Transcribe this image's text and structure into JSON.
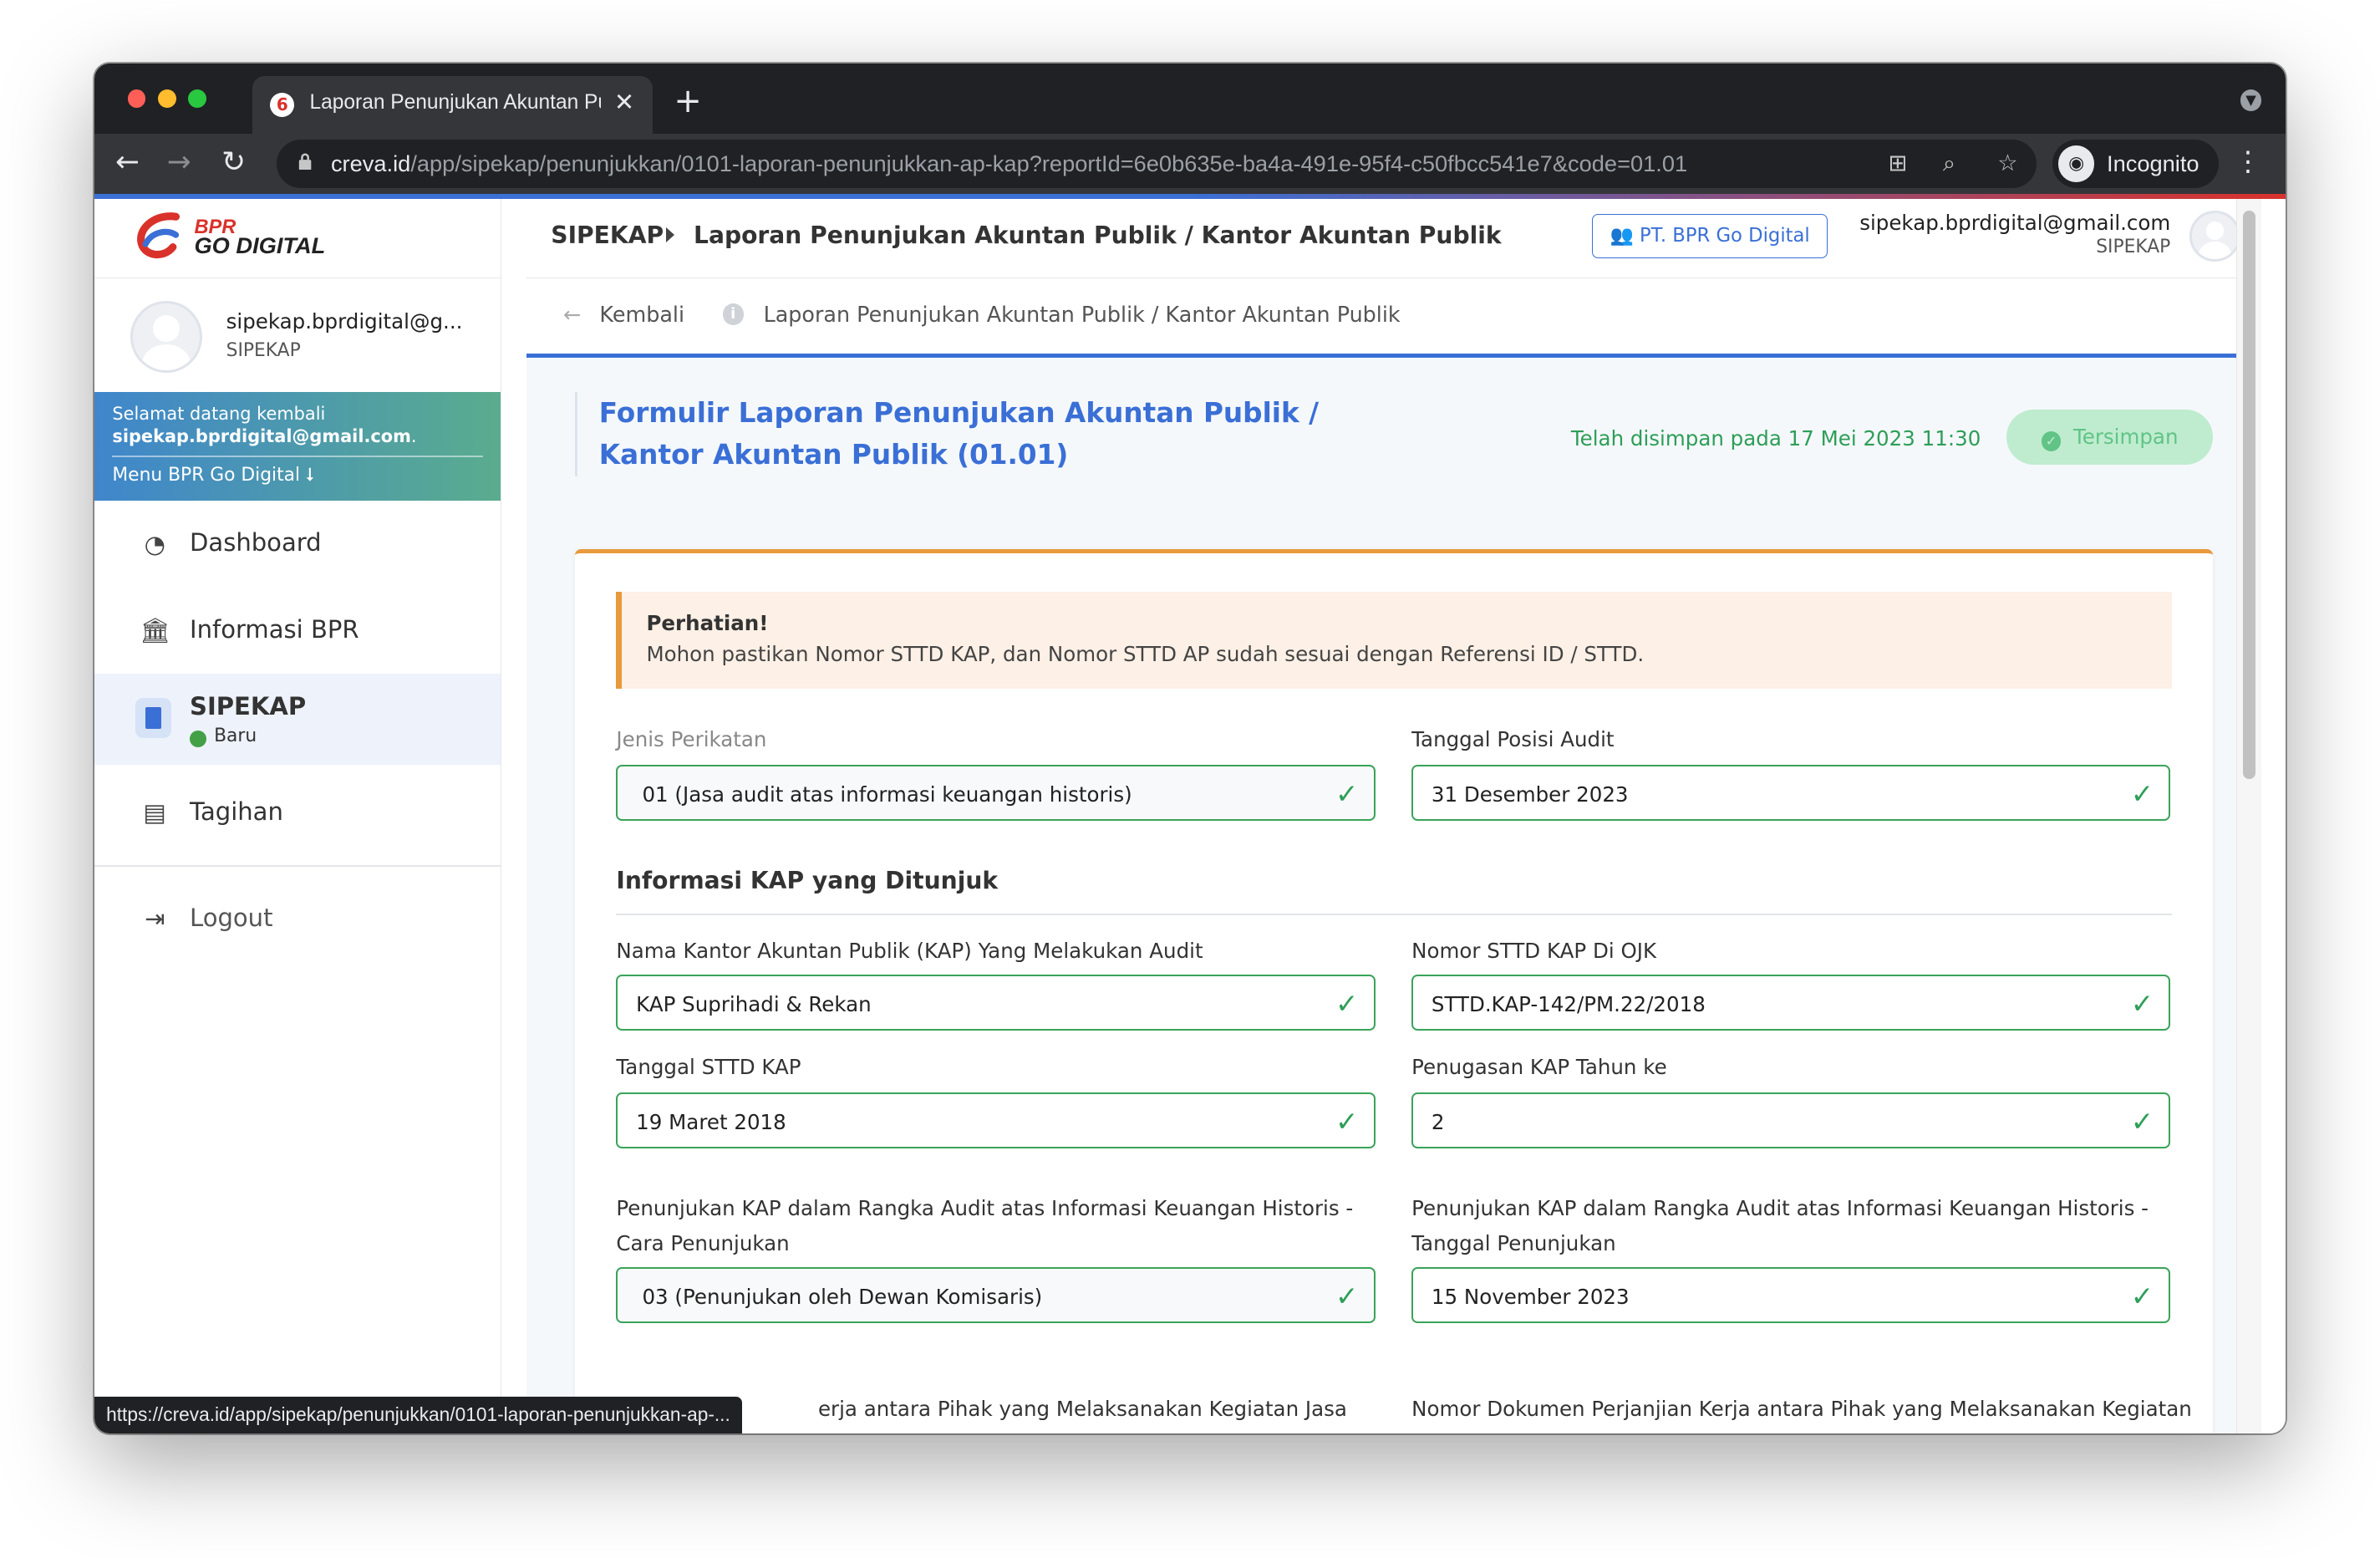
{
  "browser": {
    "tab_title": "Laporan Penunjukan Akuntan Publik / Kantor Akuntan Publik",
    "url_host": "creva.id",
    "url_path": "/app/sipekap/penunjukkan/0101-laporan-penunjukkan-ap-kap?reportId=6e0b635e-ba4a-491e-95f4-c50fbcc541e7&code=01.01",
    "incognito_label": "Incognito",
    "status_url": "https://creva.id/app/sipekap/penunjukkan/0101-laporan-penunjukkan-ap-..."
  },
  "sidebar": {
    "brand_line1": "BPR",
    "brand_line2": "GO DIGITAL",
    "user_name": "sipekap.bprdigital@g...",
    "user_role": "SIPEKAP",
    "welcome_line1": "Selamat datang kembali",
    "welcome_email": "sipekap.bprdigital@gmail.com",
    "welcome_email_suffix": ".",
    "menu_label": "Menu BPR Go Digital",
    "items": [
      {
        "label": "Dashboard",
        "icon": "dashboard-icon"
      },
      {
        "label": "Informasi BPR",
        "icon": "bank-icon"
      },
      {
        "label": "SIPEKAP",
        "icon": "clipboard-icon",
        "badge": "Baru"
      },
      {
        "label": "Tagihan",
        "icon": "billing-icon"
      }
    ],
    "logout_label": "Logout"
  },
  "header": {
    "crumb_root": "SIPEKAP",
    "crumb_page": "Laporan Penunjukan Akuntan Publik / Kantor Akuntan Publik",
    "company_button": "PT. BPR Go Digital",
    "email": "sipekap.bprdigital@gmail.com",
    "role": "SIPEKAP"
  },
  "subbar": {
    "back_label": "Kembali",
    "title": "Laporan Penunjukan Akuntan Publik / Kantor Akuntan Publik"
  },
  "form": {
    "title": "Formulir Laporan Penunjukan Akuntan Publik / Kantor Akuntan Publik (01.01)",
    "saved_text": "Telah disimpan pada 17 Mei 2023 11:30",
    "saved_button": "Tersimpan",
    "alert_title": "Perhatian!",
    "alert_body": "Mohon pastikan Nomor STTD KAP, dan Nomor STTD AP sudah sesuai dengan Referensi ID / STTD.",
    "jenis_label": "Jenis Perikatan",
    "jenis_value": "01 (Jasa audit atas informasi keuangan historis)",
    "tanggal_posisi_label": "Tanggal Posisi Audit",
    "tanggal_posisi_value": "31 Desember 2023",
    "section_kap": "Informasi KAP yang Ditunjuk",
    "nama_kap_label": "Nama Kantor Akuntan Publik (KAP) Yang Melakukan Audit",
    "nama_kap_value": "KAP Suprihadi & Rekan",
    "nomor_sttd_label": "Nomor STTD KAP Di OJK",
    "nomor_sttd_value": "STTD.KAP-142/PM.22/2018",
    "tanggal_sttd_label": "Tanggal STTD KAP",
    "tanggal_sttd_value": "19 Maret 2018",
    "penugasan_label": "Penugasan KAP Tahun ke",
    "penugasan_value": "2",
    "cara_label": "Penunjukan KAP dalam Rangka Audit atas Informasi Keuangan Historis - Cara Penunjukan",
    "cara_value": "03 (Penunjukan oleh Dewan Komisaris)",
    "tgl_penunjukan_label": "Penunjukan KAP dalam Rangka Audit atas Informasi Keuangan Historis - Tanggal Penunjukan",
    "tgl_penunjukan_value": "15 November 2023",
    "partial_left_label": "erja antara Pihak yang Melaksanakan Kegiatan Jasa",
    "partial_right_label": "Nomor Dokumen Perjanjian Kerja antara Pihak yang Melaksanakan Kegiatan"
  },
  "colors": {
    "primary": "#3a6fd6",
    "success": "#2e9e58",
    "warning": "#e89a3c",
    "brand_red": "#d9322b"
  }
}
